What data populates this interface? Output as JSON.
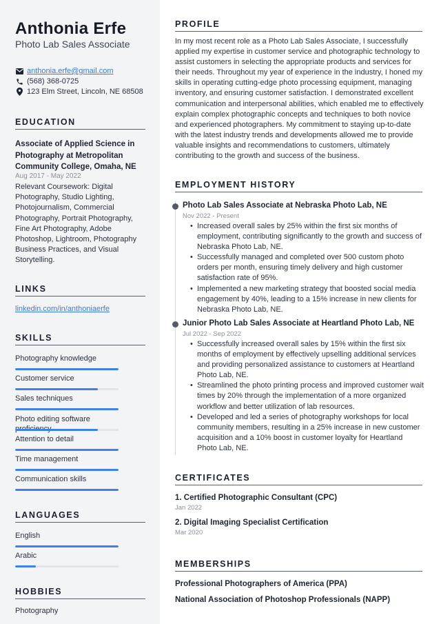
{
  "header": {
    "name": "Anthonia Erfe",
    "title": "Photo Lab Sales Associate"
  },
  "contact": {
    "email": "anthonia.erfe@gmail.com",
    "phone": "(568) 368-0725",
    "address": "123 Elm Street, Lincoln, NE 68508",
    "icons": [
      "envelope-icon",
      "phone-icon",
      "map-pin-icon"
    ]
  },
  "sections": {
    "education": "EDUCATION",
    "links": "LINKS",
    "skills": "SKILLS",
    "languages": "LANGUAGES",
    "hobbies": "HOBBIES",
    "profile": "PROFILE",
    "employment": "EMPLOYMENT HISTORY",
    "certificates": "CERTIFICATES",
    "memberships": "MEMBERSHIPS"
  },
  "education": {
    "title": "Associate of Applied Science in Photography at Metropolitan Community College, Omaha, NE",
    "date": "Aug 2017 - May 2022",
    "description": "Relevant Coursework: Digital Photography, Studio Lighting, Photojournalism, Commercial Photography, Portrait Photography, Fine Art Photography, Adobe Photoshop, Lightroom, Photography Business Practices, and Visual Storytelling."
  },
  "links": {
    "linkedin": "linkedin.com/in/anthoniaerfe"
  },
  "skills": [
    {
      "label": "Photography knowledge",
      "level": 1.0
    },
    {
      "label": "Customer service",
      "level": 0.8
    },
    {
      "label": "Sales techniques",
      "level": 1.0
    },
    {
      "label": "Photo editing software proficiency",
      "level": 0.8
    },
    {
      "label": "Attention to detail",
      "level": 1.0
    },
    {
      "label": "Time management",
      "level": 1.0
    },
    {
      "label": "Communication skills",
      "level": 1.0
    }
  ],
  "languages": [
    {
      "label": "English",
      "level": 1.0
    },
    {
      "label": "Arabic",
      "level": 0.2
    }
  ],
  "hobbies": [
    "Photography"
  ],
  "profile": "In my most recent role as a Photo Lab Sales Associate, I successfully applied my expertise in customer service and photographic technology to assist customers in selecting the appropriate products and services for their needs. Throughout my year of experience in the industry, I honed my skills in operating cutting-edge photo processing equipment, managing inventory, and ensuring customer satisfaction. I demonstrated excellent communication and interpersonal abilities, which enabled me to effectively explain complex photographic concepts and techniques to both novice and experienced photographers. My commitment to staying up-to-date with the latest industry trends and developments allowed me to provide valuable insights and recommendations to customers, ultimately contributing to the growth and success of the business.",
  "jobs": [
    {
      "title": "Photo Lab Sales Associate at Nebraska Photo Lab, NE",
      "date": "Nov 2022 - Present",
      "bullets": [
        "Increased overall sales by 25% within the first six months of employment, contributing significantly to the growth and success of Nebraska Photo Lab, NE.",
        "Successfully managed and completed over 500 custom photo orders per month, ensuring timely delivery and high customer satisfaction rate of 95%.",
        "Implemented a new marketing strategy that boosted social media engagement by 40%, leading to a 15% increase in new clients for Nebraska Photo Lab, NE."
      ]
    },
    {
      "title": "Junior Photo Lab Sales Associate at Heartland Photo Lab, NE",
      "date": "Jul 2022 - Sep 2022",
      "bullets": [
        "Successfully increased overall sales by 15% within the first six months of employment by effectively upselling additional services and providing personalized assistance to customers at Heartland Photo Lab, NE.",
        "Streamlined the photo printing process and improved customer wait times by 20% through the implementation of a more organized workflow and better utilization of lab resources.",
        "Developed and led a series of photography workshops for local community members, resulting in a 25% increase in new customer acquisition and a 10% boost in customer loyalty for Heartland Photo Lab, NE."
      ]
    }
  ],
  "certificates": [
    {
      "title": "1. Certified Photographic Consultant (CPC)",
      "date": "Jan 2022"
    },
    {
      "title": "2. Digital Imaging Specialist Certification",
      "date": "Mar 2020"
    }
  ],
  "memberships": [
    "Professional Photographers of America (PPA)",
    "National Association of Photoshop Professionals (NAPP)"
  ],
  "colors": {
    "accent": "#3d80ea",
    "sidebar_bg": "#f3f4f6",
    "link": "#3b7ae0"
  }
}
